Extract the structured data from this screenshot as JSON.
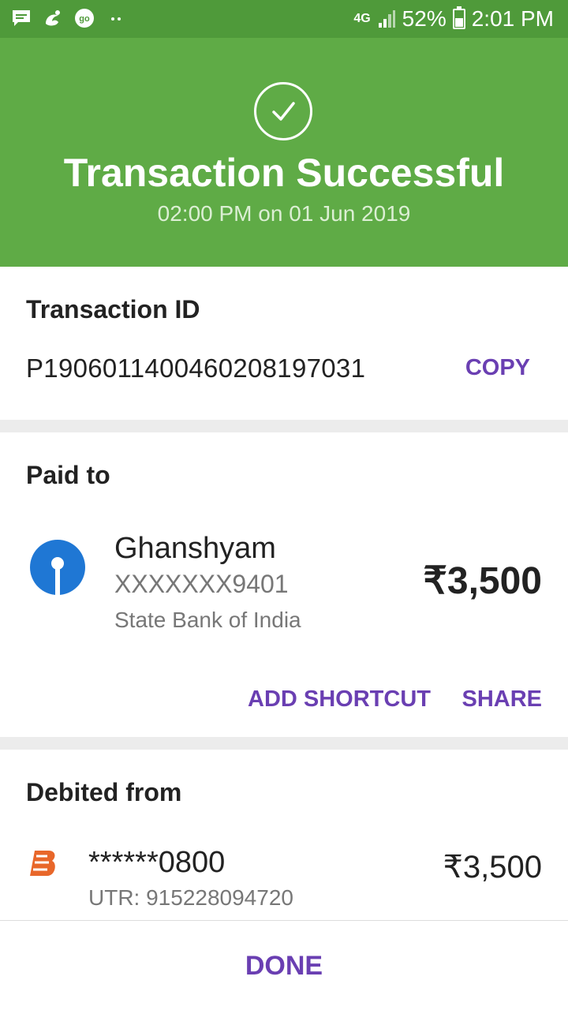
{
  "status_bar": {
    "network": "4G",
    "battery": "52%",
    "battery_level": 0.52,
    "time": "2:01 PM",
    "left_icons": [
      "message-icon",
      "uc-browser-icon",
      "go-icon",
      "more-dots-icon"
    ]
  },
  "hero": {
    "title": "Transaction Successful",
    "subtitle": "02:00 PM on 01 Jun 2019",
    "icon": "check-circle-icon",
    "color": "#5fab46"
  },
  "transaction": {
    "label": "Transaction ID",
    "id": "P1906011400460208197031",
    "copy_label": "COPY"
  },
  "paid_to": {
    "label": "Paid to",
    "name": "Ghanshyam",
    "account": "XXXXXXX9401",
    "bank": "State Bank of India",
    "amount": "₹3,500",
    "add_shortcut_label": "ADD SHORTCUT",
    "share_label": "SHARE",
    "bank_icon": "sbi-logo-icon"
  },
  "debited_from": {
    "label": "Debited from",
    "account": "******0800",
    "utr": "UTR: 915228094720",
    "amount": "₹3,500",
    "bank_icon": "bank-of-baroda-logo-icon"
  },
  "footer": {
    "done_label": "DONE"
  },
  "colors": {
    "accent": "#6a3fb2",
    "success": "#5fab46",
    "status_bar": "#4f9a3a"
  }
}
